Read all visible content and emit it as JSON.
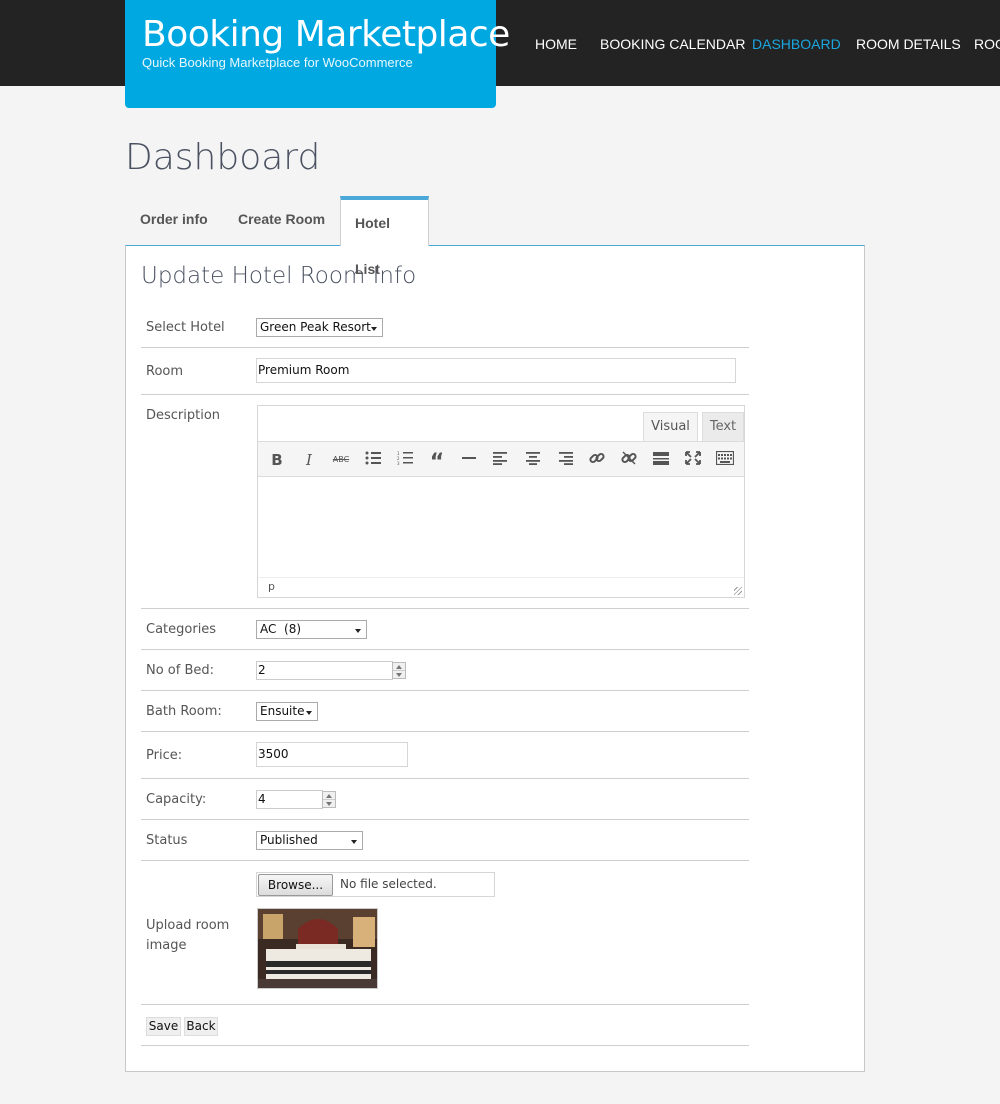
{
  "header": {
    "title": "Booking Marketplace",
    "subtitle": "Quick Booking Marketplace for WooCommerce",
    "nav": [
      {
        "label": "HOME"
      },
      {
        "label": "BOOKING CALENDAR"
      },
      {
        "label": "DASHBOARD"
      },
      {
        "label": "ROOM DETAILS"
      },
      {
        "label": "ROO"
      }
    ],
    "accent_color": "#00a8e2"
  },
  "page_title": "Dashboard",
  "tabs": [
    {
      "label": "Order info"
    },
    {
      "label": "Create Room"
    },
    {
      "label": "Hotel List"
    }
  ],
  "form": {
    "title": "Update Hotel Room Info",
    "select_hotel": {
      "label": "Select Hotel",
      "value": "Green Peak Resort"
    },
    "room": {
      "label": "Room",
      "value": "Premium Room"
    },
    "description": {
      "label": "Description",
      "tab_visual": "Visual",
      "tab_text": "Text",
      "path": "p",
      "toolbar": [
        "bold-icon",
        "italic-icon",
        "strikethrough-icon",
        "bullet-list-icon",
        "numbered-list-icon",
        "blockquote-icon",
        "horizontal-rule-icon",
        "align-left-icon",
        "align-center-icon",
        "align-right-icon",
        "link-icon",
        "unlink-icon",
        "read-more-icon",
        "fullscreen-icon",
        "toolbar-toggle-icon"
      ]
    },
    "categories": {
      "label": "Categories",
      "value": "AC  (8)"
    },
    "beds": {
      "label": "No of Bed:",
      "value": "2"
    },
    "bath": {
      "label": "Bath Room:",
      "value": "Ensuite"
    },
    "price": {
      "label": "Price:",
      "value": "3500"
    },
    "capacity": {
      "label": "Capacity:",
      "value": "4"
    },
    "status": {
      "label": "Status",
      "value": "Published"
    },
    "upload": {
      "label": "Upload room image",
      "browse": "Browse...",
      "file": "No file selected."
    },
    "save": "Save",
    "back": "Back"
  }
}
